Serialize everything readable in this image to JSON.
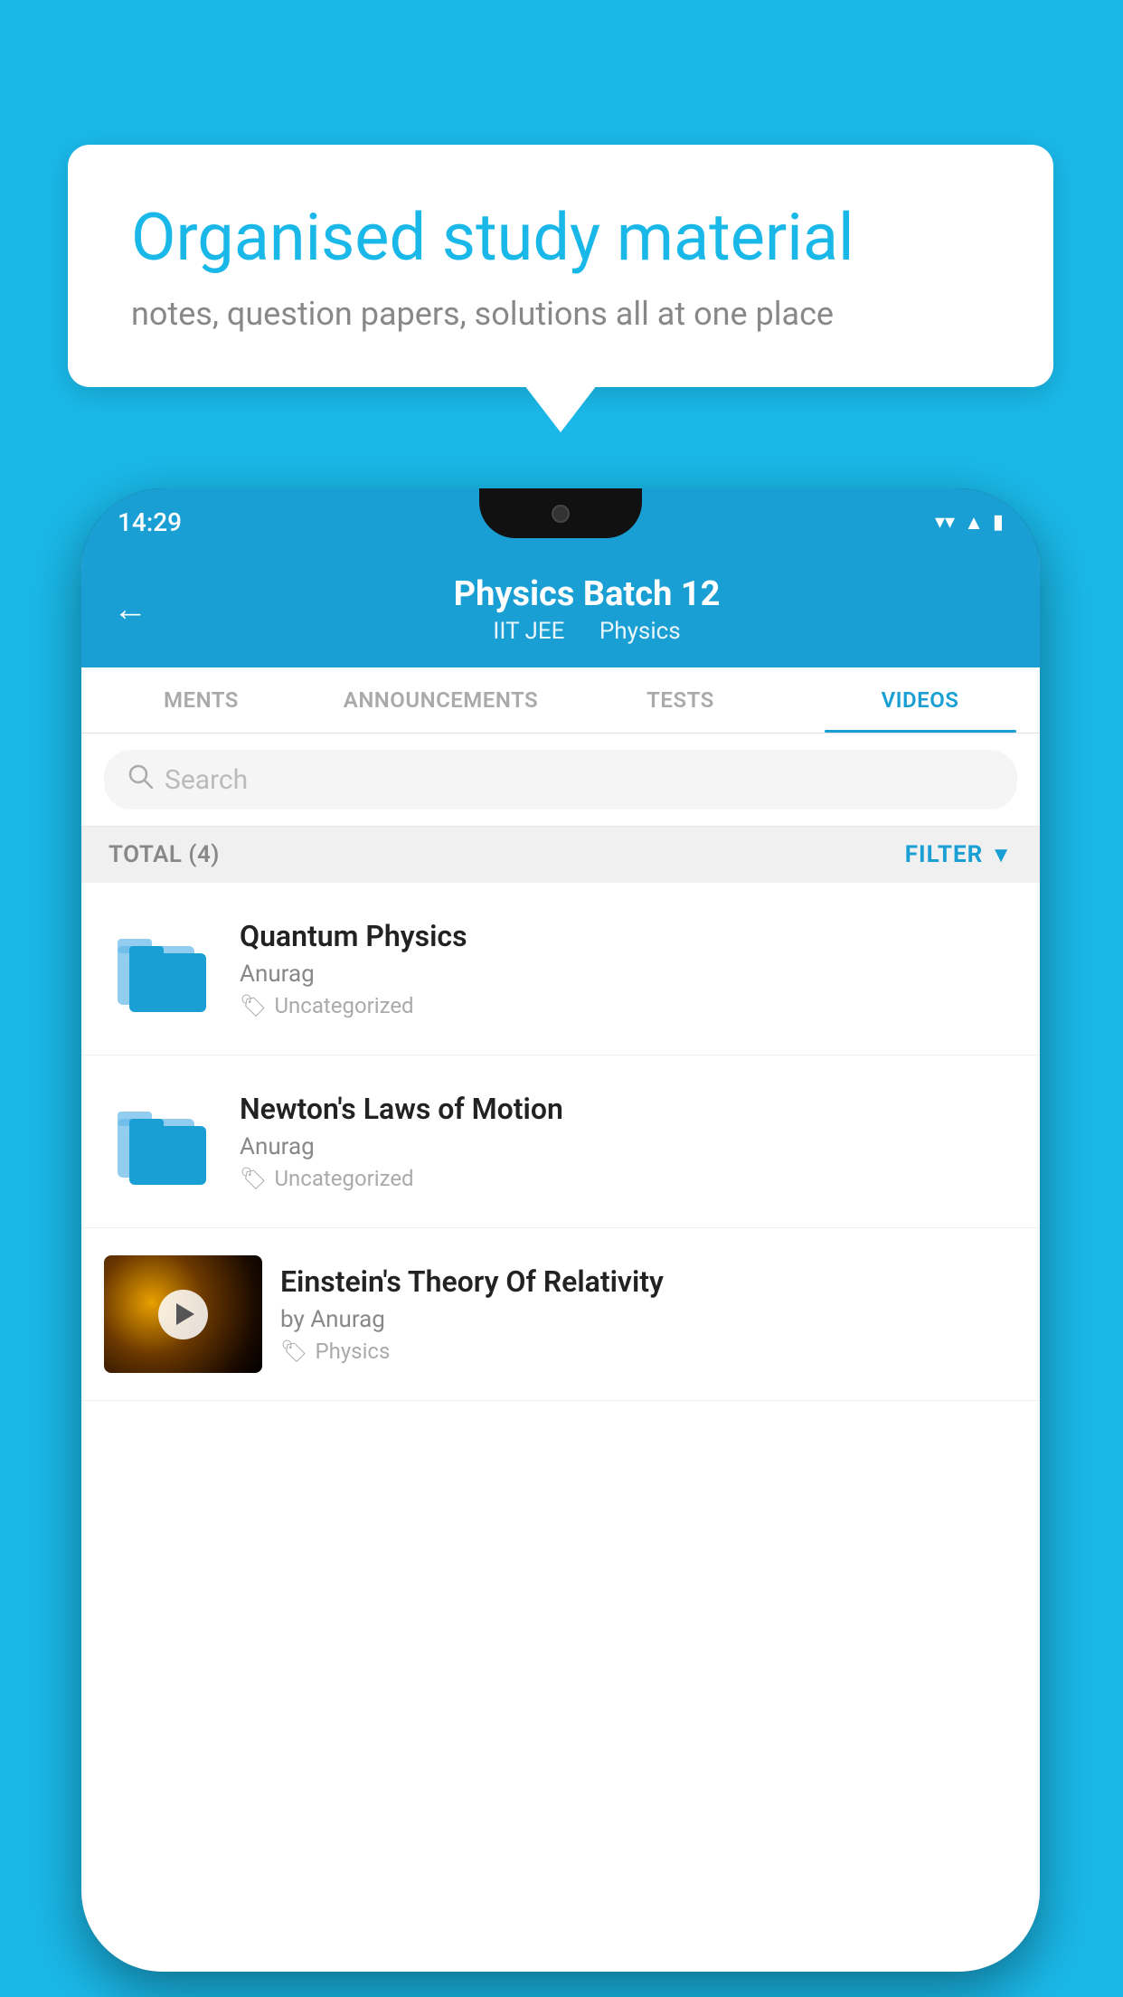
{
  "background_color": "#1ab8e8",
  "speech_bubble": {
    "title": "Organised study material",
    "subtitle": "notes, question papers, solutions all at one place"
  },
  "phone": {
    "status_bar": {
      "time": "14:29",
      "wifi_icon": "▼",
      "signal_icon": "▲",
      "battery_icon": "▮"
    },
    "header": {
      "back_label": "←",
      "title": "Physics Batch 12",
      "subtitle1": "IIT JEE",
      "subtitle2": "Physics"
    },
    "tabs": [
      {
        "label": "MENTS",
        "active": false
      },
      {
        "label": "ANNOUNCEMENTS",
        "active": false
      },
      {
        "label": "TESTS",
        "active": false
      },
      {
        "label": "VIDEOS",
        "active": true
      }
    ],
    "search": {
      "placeholder": "Search"
    },
    "filter_bar": {
      "total_label": "TOTAL (4)",
      "filter_label": "FILTER"
    },
    "videos": [
      {
        "title": "Quantum Physics",
        "author": "Anurag",
        "tag": "Uncategorized",
        "type": "folder"
      },
      {
        "title": "Newton's Laws of Motion",
        "author": "Anurag",
        "tag": "Uncategorized",
        "type": "folder"
      },
      {
        "title": "Einstein's Theory Of Relativity",
        "author": "by Anurag",
        "tag": "Physics",
        "type": "video"
      }
    ]
  }
}
